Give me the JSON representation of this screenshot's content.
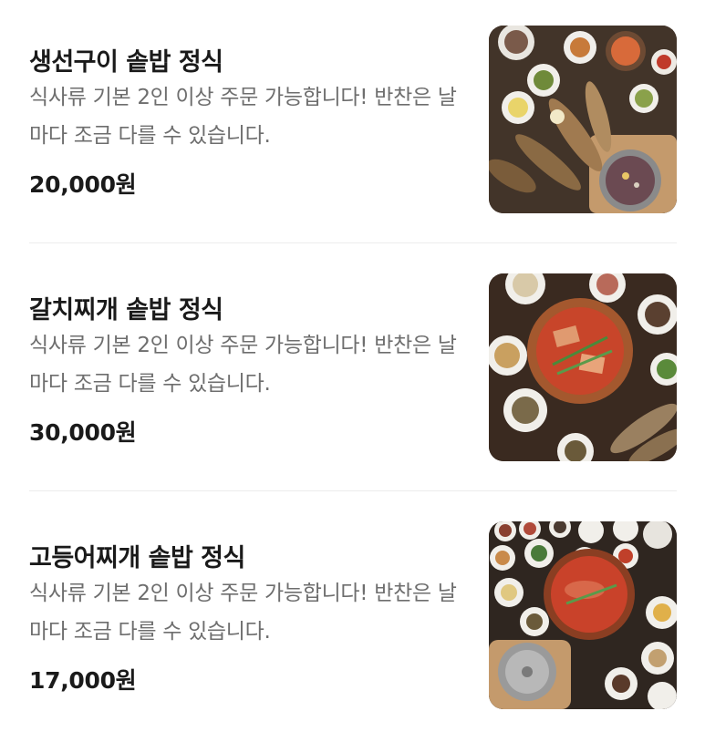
{
  "menu": {
    "items": [
      {
        "title": "생선구이 솥밥 정식",
        "description": "식사류 기본 2인 이상 주문 가능합니다! 반찬은 날마다 조금 다를 수 있습니다.",
        "price": "20,000원"
      },
      {
        "title": "갈치찌개 솥밥 정식",
        "description": "식사류 기본 2인 이상 주문 가능합니다! 반찬은 날마다 조금 다를 수 있습니다.",
        "price": "30,000원"
      },
      {
        "title": "고등어찌개 솥밥 정식",
        "description": "식사류 기본 2인 이상 주문 가능합니다! 반찬은 날마다 조금 다를 수 있습니다.",
        "price": "17,000원"
      }
    ]
  }
}
